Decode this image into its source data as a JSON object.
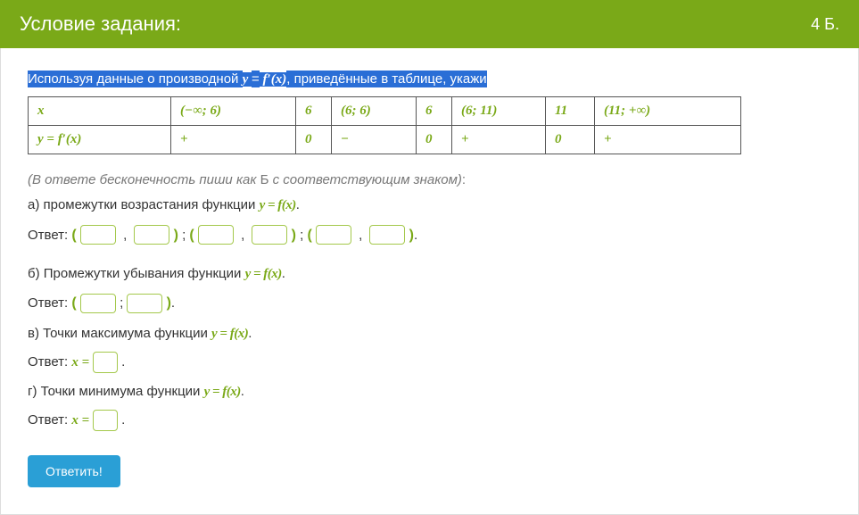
{
  "header": {
    "title": "Условие задания:",
    "score": "4 Б."
  },
  "intro": {
    "part1": "Используя данные о производной ",
    "formula_pre": "y ",
    "formula_eq": "=",
    "formula_post": " f′(x)",
    "part2": ", приведённые в таблице, укажи"
  },
  "table": {
    "row1": [
      "x",
      "(−∞; 6)",
      "6",
      "(6; 6)",
      "6",
      "(6; 11)",
      "11",
      "(11; +∞)"
    ],
    "row2": [
      "y = f′(x)",
      "+",
      "0",
      "−",
      "0",
      "+",
      "0",
      "+"
    ]
  },
  "note": {
    "italic1": "(В ответе бесконечность пиши как ",
    "upright": "Б",
    "italic2": " с соответствующим знаком)",
    "colon": ":"
  },
  "parts": {
    "a": {
      "text": "а) промежутки возрастания функции ",
      "formula": "y = f(x)",
      "dot": "."
    },
    "b": {
      "text": "б) Промежутки убывания функции ",
      "formula": "y = f(x)",
      "dot": "."
    },
    "c": {
      "text": "в) Точки максимума функции ",
      "formula": "y = f(x)",
      "dot": "."
    },
    "d": {
      "text": "г) Точки минимума функции ",
      "formula": "y = f(x)",
      "dot": "."
    }
  },
  "labels": {
    "answer": "Ответ: ",
    "x_eq": "x = "
  },
  "button": {
    "submit": "Ответить!"
  },
  "chart_data": {
    "type": "table",
    "columns": [
      "x",
      "(−∞; 6)",
      "6",
      "(6; 6)",
      "6",
      "(6; 11)",
      "11",
      "(11; +∞)"
    ],
    "rows": [
      {
        "label": "y = f′(x)",
        "values": [
          "+",
          "0",
          "−",
          "0",
          "+",
          "0",
          "+"
        ]
      }
    ]
  }
}
